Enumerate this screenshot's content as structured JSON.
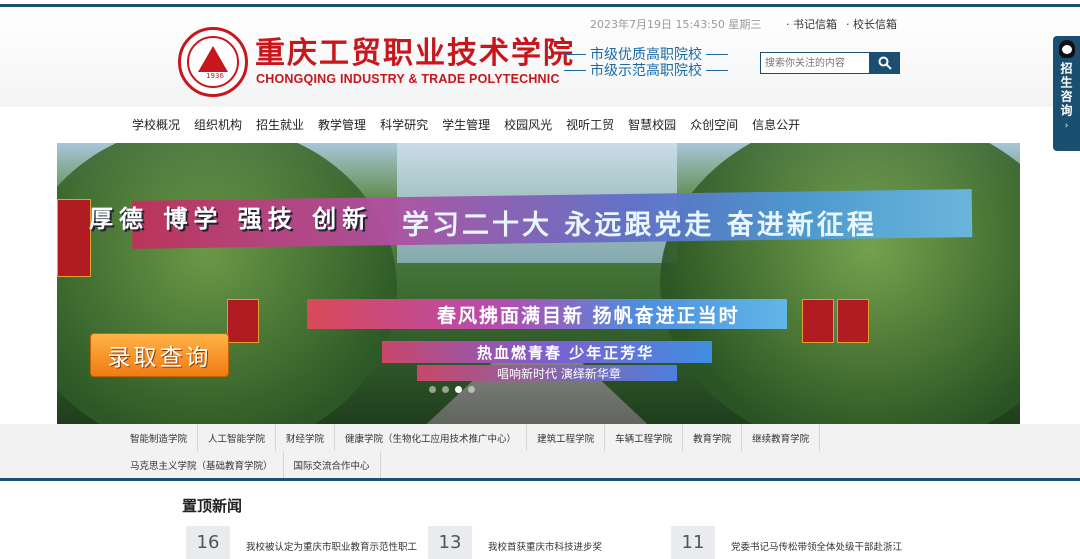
{
  "header": {
    "school_name_cn": "重庆工贸职业技术学院",
    "school_name_en": "CHONGQING INDUSTRY & TRADE POLYTECHNIC",
    "founded_year": "1936",
    "honors": [
      "市级优质高职院校",
      "市级示范高职院校"
    ],
    "datetime": "2023年7月19日 15:43:50 星期三",
    "mail_links": [
      "· 书记信箱",
      "· 校长信箱"
    ],
    "search_placeholder": "搜索你关注的内容",
    "brand_color": "#c8161d",
    "accent_color": "#1b4f72"
  },
  "side_tab": {
    "label": "招生咨询",
    "icon": "qq-icon"
  },
  "nav": {
    "items": [
      "学校概况",
      "组织机构",
      "招生就业",
      "教学管理",
      "科学研究",
      "学生管理",
      "校园风光",
      "视听工贸",
      "智慧校园",
      "众创空间",
      "信息公开"
    ]
  },
  "banner": {
    "slogan": "厚德 博学 强技 创新",
    "main_banner_text": "学习二十大 永远跟党走 奋进新征程",
    "banner2_text": "春风拂面满目新 扬帆奋进正当时",
    "banner3_text": "热血燃青春 少年正芳华",
    "banner4_text": "唱响新时代 演绎新华章",
    "enroll_button": "录取查询",
    "slide_count": 4,
    "active_slide": 2
  },
  "colleges": {
    "row1": [
      "智能制造学院",
      "人工智能学院",
      "财经学院",
      "健康学院（生物化工应用技术推广中心）",
      "建筑工程学院",
      "车辆工程学院",
      "教育学院",
      "继续教育学院"
    ],
    "row2": [
      "马克思主义学院（基础教育学院）",
      "国际交流合作中心"
    ]
  },
  "news": {
    "heading": "置顶新闻",
    "items": [
      {
        "day": "16",
        "title": "我校被认定为重庆市职业教育示范性职工"
      },
      {
        "day": "13",
        "title": "我校首获重庆市科技进步奖"
      },
      {
        "day": "11",
        "title": "党委书记马传松带领全体处级干部赴浙江"
      }
    ]
  }
}
